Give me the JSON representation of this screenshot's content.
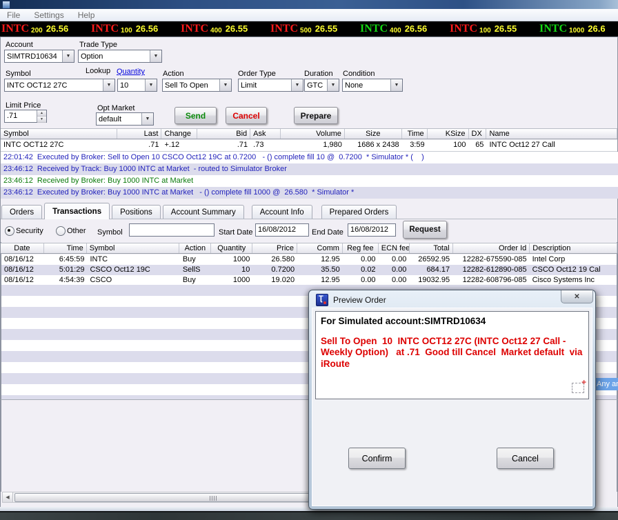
{
  "titlebar": {
    "menu": [
      "File",
      "Settings",
      "Help"
    ]
  },
  "ticker": [
    {
      "symbol": "INTC",
      "qty": "200",
      "price": "26.56",
      "color": "#ff1a1a"
    },
    {
      "symbol": "INTC",
      "qty": "100",
      "price": "26.56",
      "color": "#ff1a1a"
    },
    {
      "symbol": "INTC",
      "qty": "400",
      "price": "26.55",
      "color": "#ff1a1a"
    },
    {
      "symbol": "INTC",
      "qty": "500",
      "price": "26.55",
      "color": "#ff1a1a"
    },
    {
      "symbol": "INTC",
      "qty": "400",
      "price": "26.56",
      "color": "#13d813"
    },
    {
      "symbol": "INTC",
      "qty": "100",
      "price": "26.55",
      "color": "#ff1a1a"
    },
    {
      "symbol": "INTC",
      "qty": "1000",
      "price": "26.6",
      "color": "#13d813"
    }
  ],
  "form": {
    "account_label": "Account",
    "account_value": "SIMTRD10634",
    "trade_type_label": "Trade Type",
    "trade_type_value": "Option",
    "symbol_label": "Symbol",
    "lookup_label": "Lookup",
    "symbol_value": "INTC OCT12 27C",
    "quantity_label": "Quantity",
    "quantity_value": "10",
    "action_label": "Action",
    "action_value": "Sell To Open",
    "order_type_label": "Order Type",
    "order_type_value": "Limit",
    "duration_label": "Duration",
    "duration_value": "GTC",
    "condition_label": "Condition",
    "condition_value": "None",
    "limit_price_label": "Limit Price",
    "limit_price_value": ".71",
    "opt_market_label": "Opt Market",
    "opt_market_value": "default",
    "send_label": "Send",
    "cancel_label": "Cancel",
    "prepare_label": "Prepare"
  },
  "quote": {
    "columns": [
      "Symbol",
      "Last",
      "Change",
      "Bid",
      "Ask",
      "Volume",
      "Size",
      "Time",
      "KSize",
      "DX",
      "Name"
    ],
    "row": [
      "INTC OCT12 27C",
      ".71",
      "+.12",
      ".71",
      ".73",
      "1,980",
      "1686 x 2438",
      "3:59",
      "100",
      "65",
      "INTC Oct12 27 Call"
    ]
  },
  "log": [
    {
      "text": "22:01:42  Executed by Broker: Sell to Open 10 CSCO Oct12 19C at 0.7200   - () complete fill 10 @  0.7200  * Simulator * (    )"
    },
    {
      "text": "23:46:12  Received by Track: Buy 1000 INTC at Market  - routed to Simulator Broker"
    },
    {
      "text": "23:46:12  Received by Broker: Buy 1000 INTC at Market"
    },
    {
      "text": "23:46:12  Executed by Broker: Buy 1000 INTC at Market   - () complete fill 1000 @  26.580  * Simulator *"
    }
  ],
  "tabs": [
    "Orders",
    "Transactions",
    "Positions",
    "Account Summary",
    "Account Info",
    "Prepared Orders"
  ],
  "filter": {
    "security_label": "Security",
    "other_label": "Other",
    "symbol_label": "Symbol",
    "symbol_value": "",
    "start_label": "Start Date",
    "start_value": "16/08/2012",
    "end_label": "End Date",
    "end_value": "16/08/2012",
    "request_label": "Request"
  },
  "transactions": {
    "columns": [
      "Date",
      "Time",
      "Symbol",
      "Action",
      "Quantity",
      "Price",
      "Comm",
      "Reg fee",
      "ECN fee",
      "Total",
      "Order Id",
      "Description"
    ],
    "rows": [
      [
        "08/16/12",
        "6:45:59",
        "INTC",
        "Buy",
        "1000",
        "26.580",
        "12.95",
        "0.00",
        "0.00",
        "26592.95",
        "12282-675590-085",
        "Intel Corp"
      ],
      [
        "08/16/12",
        "5:01:29",
        "CSCO Oct12 19C",
        "SellS",
        "10",
        "0.7200",
        "35.50",
        "0.02",
        "0.00",
        "684.17",
        "12282-612890-085",
        "CSCO Oct12 19 Cal"
      ],
      [
        "08/16/12",
        "4:54:39",
        "CSCO",
        "Buy",
        "1000",
        "19.020",
        "12.95",
        "0.00",
        "0.00",
        "19032.95",
        "12282-608796-085",
        "Cisco Systems  Inc"
      ]
    ]
  },
  "dialog": {
    "title": "Preview Order",
    "account_line": "For Simulated account:SIMTRD10634",
    "order_text": "Sell To Open  10  INTC OCT12 27C (INTC Oct12 27 Call - Weekly Option)   at .71  Good till Cancel  Market default  via iRoute",
    "confirm_label": "Confirm",
    "cancel_label": "Cancel"
  },
  "overlay": {
    "any_area": "Any are"
  }
}
